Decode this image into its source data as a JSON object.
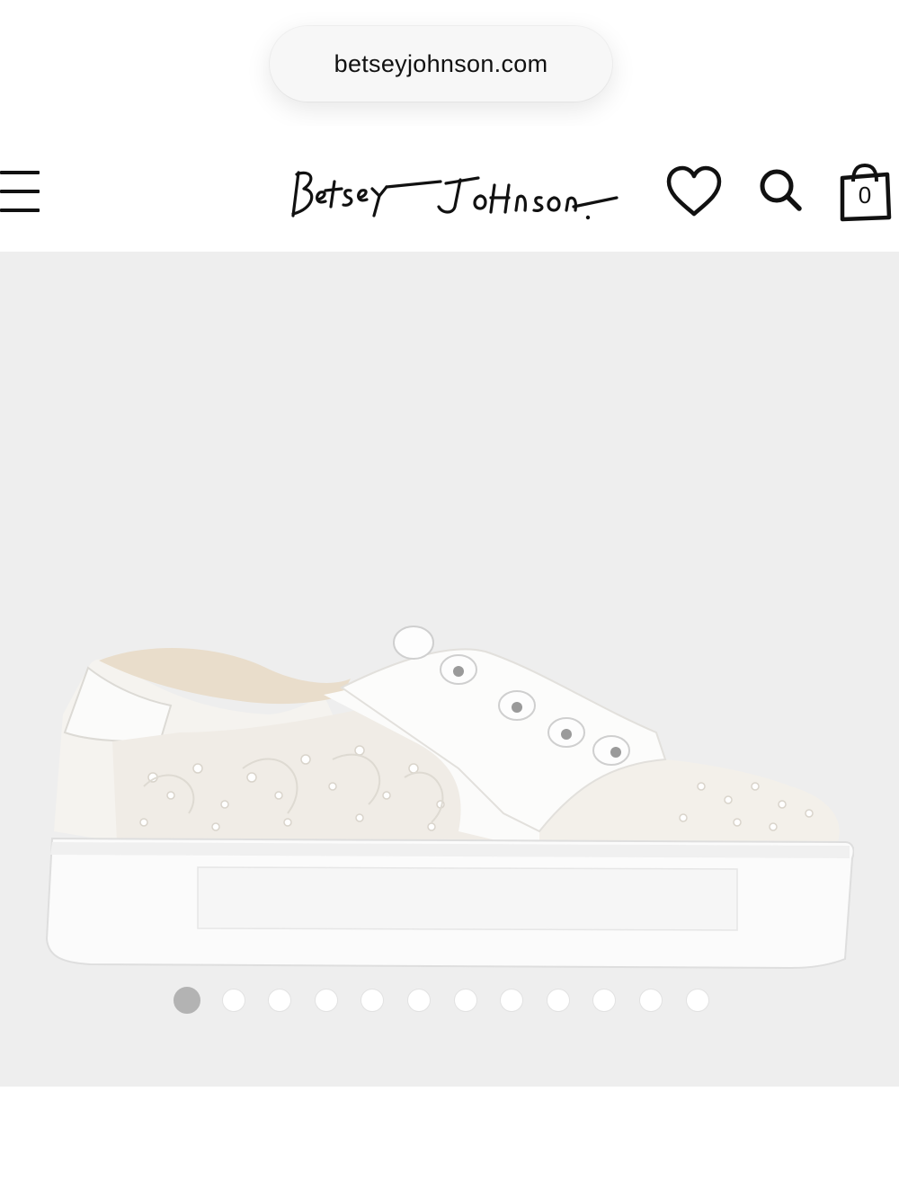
{
  "browser": {
    "url": "betseyjohnson.com"
  },
  "header": {
    "logo_text": "Betsey Johnson",
    "bag_count": "0",
    "icons": [
      "menu-icon",
      "heart-icon",
      "search-icon",
      "shopping-bag-icon"
    ]
  },
  "gallery": {
    "image_alt": "white lace sneaker",
    "slide_count": 12,
    "active_slide": 1,
    "colors": {
      "background": "#eeeeee",
      "active_dot": "#b3b3b3",
      "inactive_dot": "#ffffff"
    }
  }
}
